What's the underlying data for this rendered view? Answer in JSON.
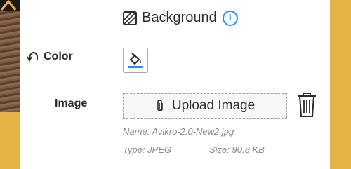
{
  "panel": {
    "title": "Background",
    "info_icon": "i"
  },
  "color": {
    "label": "Color",
    "reset_icon": "undo-arrow-icon",
    "swatch_icon": "paint-bucket-icon",
    "accent": "#2d8cf0",
    "swatch_line_color": "#2d8cf0"
  },
  "image": {
    "label": "Image",
    "upload_label": "Upload Image",
    "file_name": "Name: Avikro-2.0-New2.jpg",
    "file_type": "Type: JPEG",
    "file_size": "Size: 90.8 KB"
  },
  "colors": {
    "canvas_yellow": "#e4b344",
    "panel_bg": "#ffffff",
    "text": "#2b2b2b",
    "meta_text": "#8a8a8a"
  }
}
